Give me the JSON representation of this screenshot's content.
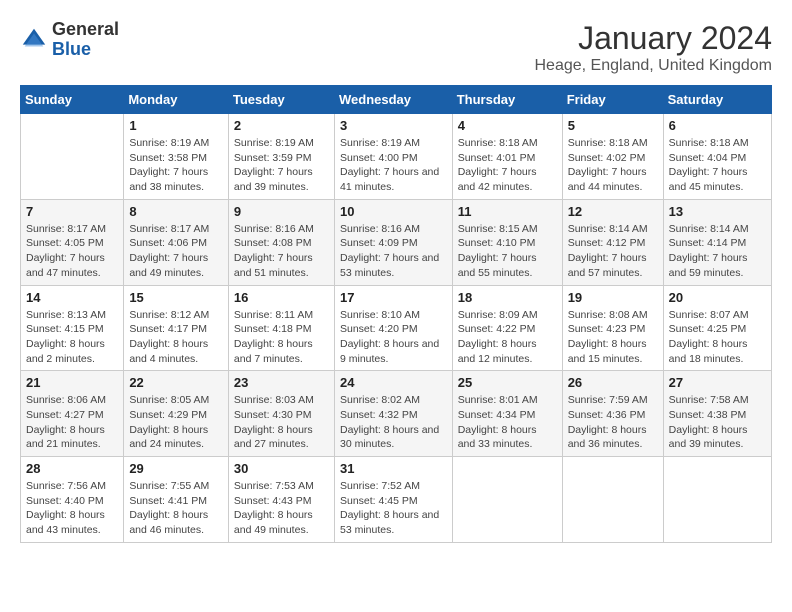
{
  "logo": {
    "general": "General",
    "blue": "Blue"
  },
  "title": "January 2024",
  "subtitle": "Heage, England, United Kingdom",
  "days_of_week": [
    "Sunday",
    "Monday",
    "Tuesday",
    "Wednesday",
    "Thursday",
    "Friday",
    "Saturday"
  ],
  "weeks": [
    [
      {
        "day": "",
        "info": ""
      },
      {
        "day": "1",
        "info": "Sunrise: 8:19 AM\nSunset: 3:58 PM\nDaylight: 7 hours and 38 minutes."
      },
      {
        "day": "2",
        "info": "Sunrise: 8:19 AM\nSunset: 3:59 PM\nDaylight: 7 hours and 39 minutes."
      },
      {
        "day": "3",
        "info": "Sunrise: 8:19 AM\nSunset: 4:00 PM\nDaylight: 7 hours and 41 minutes."
      },
      {
        "day": "4",
        "info": "Sunrise: 8:18 AM\nSunset: 4:01 PM\nDaylight: 7 hours and 42 minutes."
      },
      {
        "day": "5",
        "info": "Sunrise: 8:18 AM\nSunset: 4:02 PM\nDaylight: 7 hours and 44 minutes."
      },
      {
        "day": "6",
        "info": "Sunrise: 8:18 AM\nSunset: 4:04 PM\nDaylight: 7 hours and 45 minutes."
      }
    ],
    [
      {
        "day": "7",
        "info": "Sunrise: 8:17 AM\nSunset: 4:05 PM\nDaylight: 7 hours and 47 minutes."
      },
      {
        "day": "8",
        "info": "Sunrise: 8:17 AM\nSunset: 4:06 PM\nDaylight: 7 hours and 49 minutes."
      },
      {
        "day": "9",
        "info": "Sunrise: 8:16 AM\nSunset: 4:08 PM\nDaylight: 7 hours and 51 minutes."
      },
      {
        "day": "10",
        "info": "Sunrise: 8:16 AM\nSunset: 4:09 PM\nDaylight: 7 hours and 53 minutes."
      },
      {
        "day": "11",
        "info": "Sunrise: 8:15 AM\nSunset: 4:10 PM\nDaylight: 7 hours and 55 minutes."
      },
      {
        "day": "12",
        "info": "Sunrise: 8:14 AM\nSunset: 4:12 PM\nDaylight: 7 hours and 57 minutes."
      },
      {
        "day": "13",
        "info": "Sunrise: 8:14 AM\nSunset: 4:14 PM\nDaylight: 7 hours and 59 minutes."
      }
    ],
    [
      {
        "day": "14",
        "info": "Sunrise: 8:13 AM\nSunset: 4:15 PM\nDaylight: 8 hours and 2 minutes."
      },
      {
        "day": "15",
        "info": "Sunrise: 8:12 AM\nSunset: 4:17 PM\nDaylight: 8 hours and 4 minutes."
      },
      {
        "day": "16",
        "info": "Sunrise: 8:11 AM\nSunset: 4:18 PM\nDaylight: 8 hours and 7 minutes."
      },
      {
        "day": "17",
        "info": "Sunrise: 8:10 AM\nSunset: 4:20 PM\nDaylight: 8 hours and 9 minutes."
      },
      {
        "day": "18",
        "info": "Sunrise: 8:09 AM\nSunset: 4:22 PM\nDaylight: 8 hours and 12 minutes."
      },
      {
        "day": "19",
        "info": "Sunrise: 8:08 AM\nSunset: 4:23 PM\nDaylight: 8 hours and 15 minutes."
      },
      {
        "day": "20",
        "info": "Sunrise: 8:07 AM\nSunset: 4:25 PM\nDaylight: 8 hours and 18 minutes."
      }
    ],
    [
      {
        "day": "21",
        "info": "Sunrise: 8:06 AM\nSunset: 4:27 PM\nDaylight: 8 hours and 21 minutes."
      },
      {
        "day": "22",
        "info": "Sunrise: 8:05 AM\nSunset: 4:29 PM\nDaylight: 8 hours and 24 minutes."
      },
      {
        "day": "23",
        "info": "Sunrise: 8:03 AM\nSunset: 4:30 PM\nDaylight: 8 hours and 27 minutes."
      },
      {
        "day": "24",
        "info": "Sunrise: 8:02 AM\nSunset: 4:32 PM\nDaylight: 8 hours and 30 minutes."
      },
      {
        "day": "25",
        "info": "Sunrise: 8:01 AM\nSunset: 4:34 PM\nDaylight: 8 hours and 33 minutes."
      },
      {
        "day": "26",
        "info": "Sunrise: 7:59 AM\nSunset: 4:36 PM\nDaylight: 8 hours and 36 minutes."
      },
      {
        "day": "27",
        "info": "Sunrise: 7:58 AM\nSunset: 4:38 PM\nDaylight: 8 hours and 39 minutes."
      }
    ],
    [
      {
        "day": "28",
        "info": "Sunrise: 7:56 AM\nSunset: 4:40 PM\nDaylight: 8 hours and 43 minutes."
      },
      {
        "day": "29",
        "info": "Sunrise: 7:55 AM\nSunset: 4:41 PM\nDaylight: 8 hours and 46 minutes."
      },
      {
        "day": "30",
        "info": "Sunrise: 7:53 AM\nSunset: 4:43 PM\nDaylight: 8 hours and 49 minutes."
      },
      {
        "day": "31",
        "info": "Sunrise: 7:52 AM\nSunset: 4:45 PM\nDaylight: 8 hours and 53 minutes."
      },
      {
        "day": "",
        "info": ""
      },
      {
        "day": "",
        "info": ""
      },
      {
        "day": "",
        "info": ""
      }
    ]
  ]
}
